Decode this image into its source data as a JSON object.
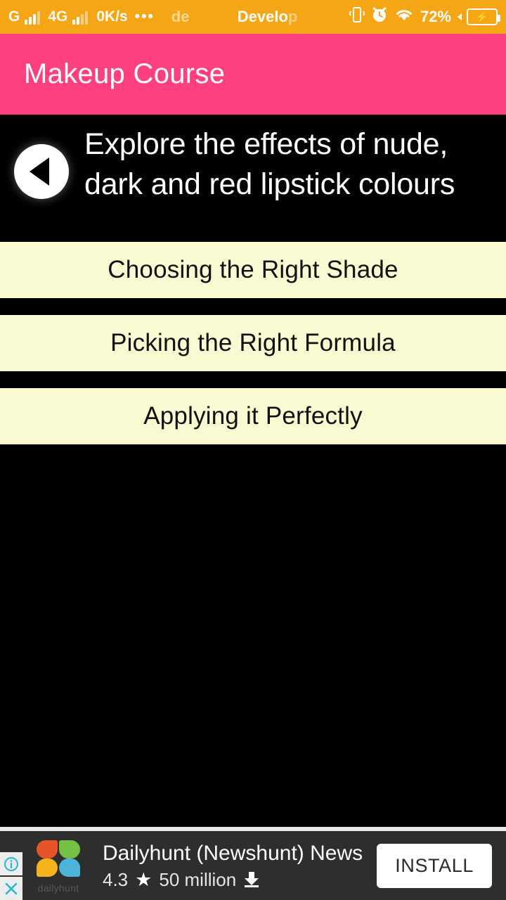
{
  "statusbar": {
    "network_label": "G",
    "network2_label": "4G",
    "speed": "0K/s",
    "dots": "•••",
    "ticker_partial": "de",
    "ticker_text": "Develo",
    "ticker_text_fade": "p",
    "battery_percent": "72%",
    "icons": {
      "vibrate": "vibrate-icon",
      "alarm": "alarm-icon",
      "wifi": "wifi-icon",
      "battery_charging": "battery-charging-icon"
    }
  },
  "appbar": {
    "title": "Makeup Course",
    "background": "#FF4080"
  },
  "header": {
    "back_icon": "back-triangle-icon",
    "title": "Explore the effects of nude, dark and red lipstick colours"
  },
  "list": {
    "item_background": "#FAFAD2",
    "items": [
      {
        "label": "Choosing the Right Shade"
      },
      {
        "label": "Picking the Right Formula"
      },
      {
        "label": "Applying it Perfectly"
      }
    ]
  },
  "ad": {
    "app_name": "Dailyhunt (Newshunt) News",
    "rating": "4.3",
    "star": "★",
    "downloads": "50 million",
    "install_label": "INSTALL",
    "logo_word": "dailyhunt",
    "info_icon": "info-icon",
    "close_icon": "close-icon",
    "info_glyph": "ⓘ",
    "close_glyph": "✕",
    "background": "#2E2E2E"
  }
}
